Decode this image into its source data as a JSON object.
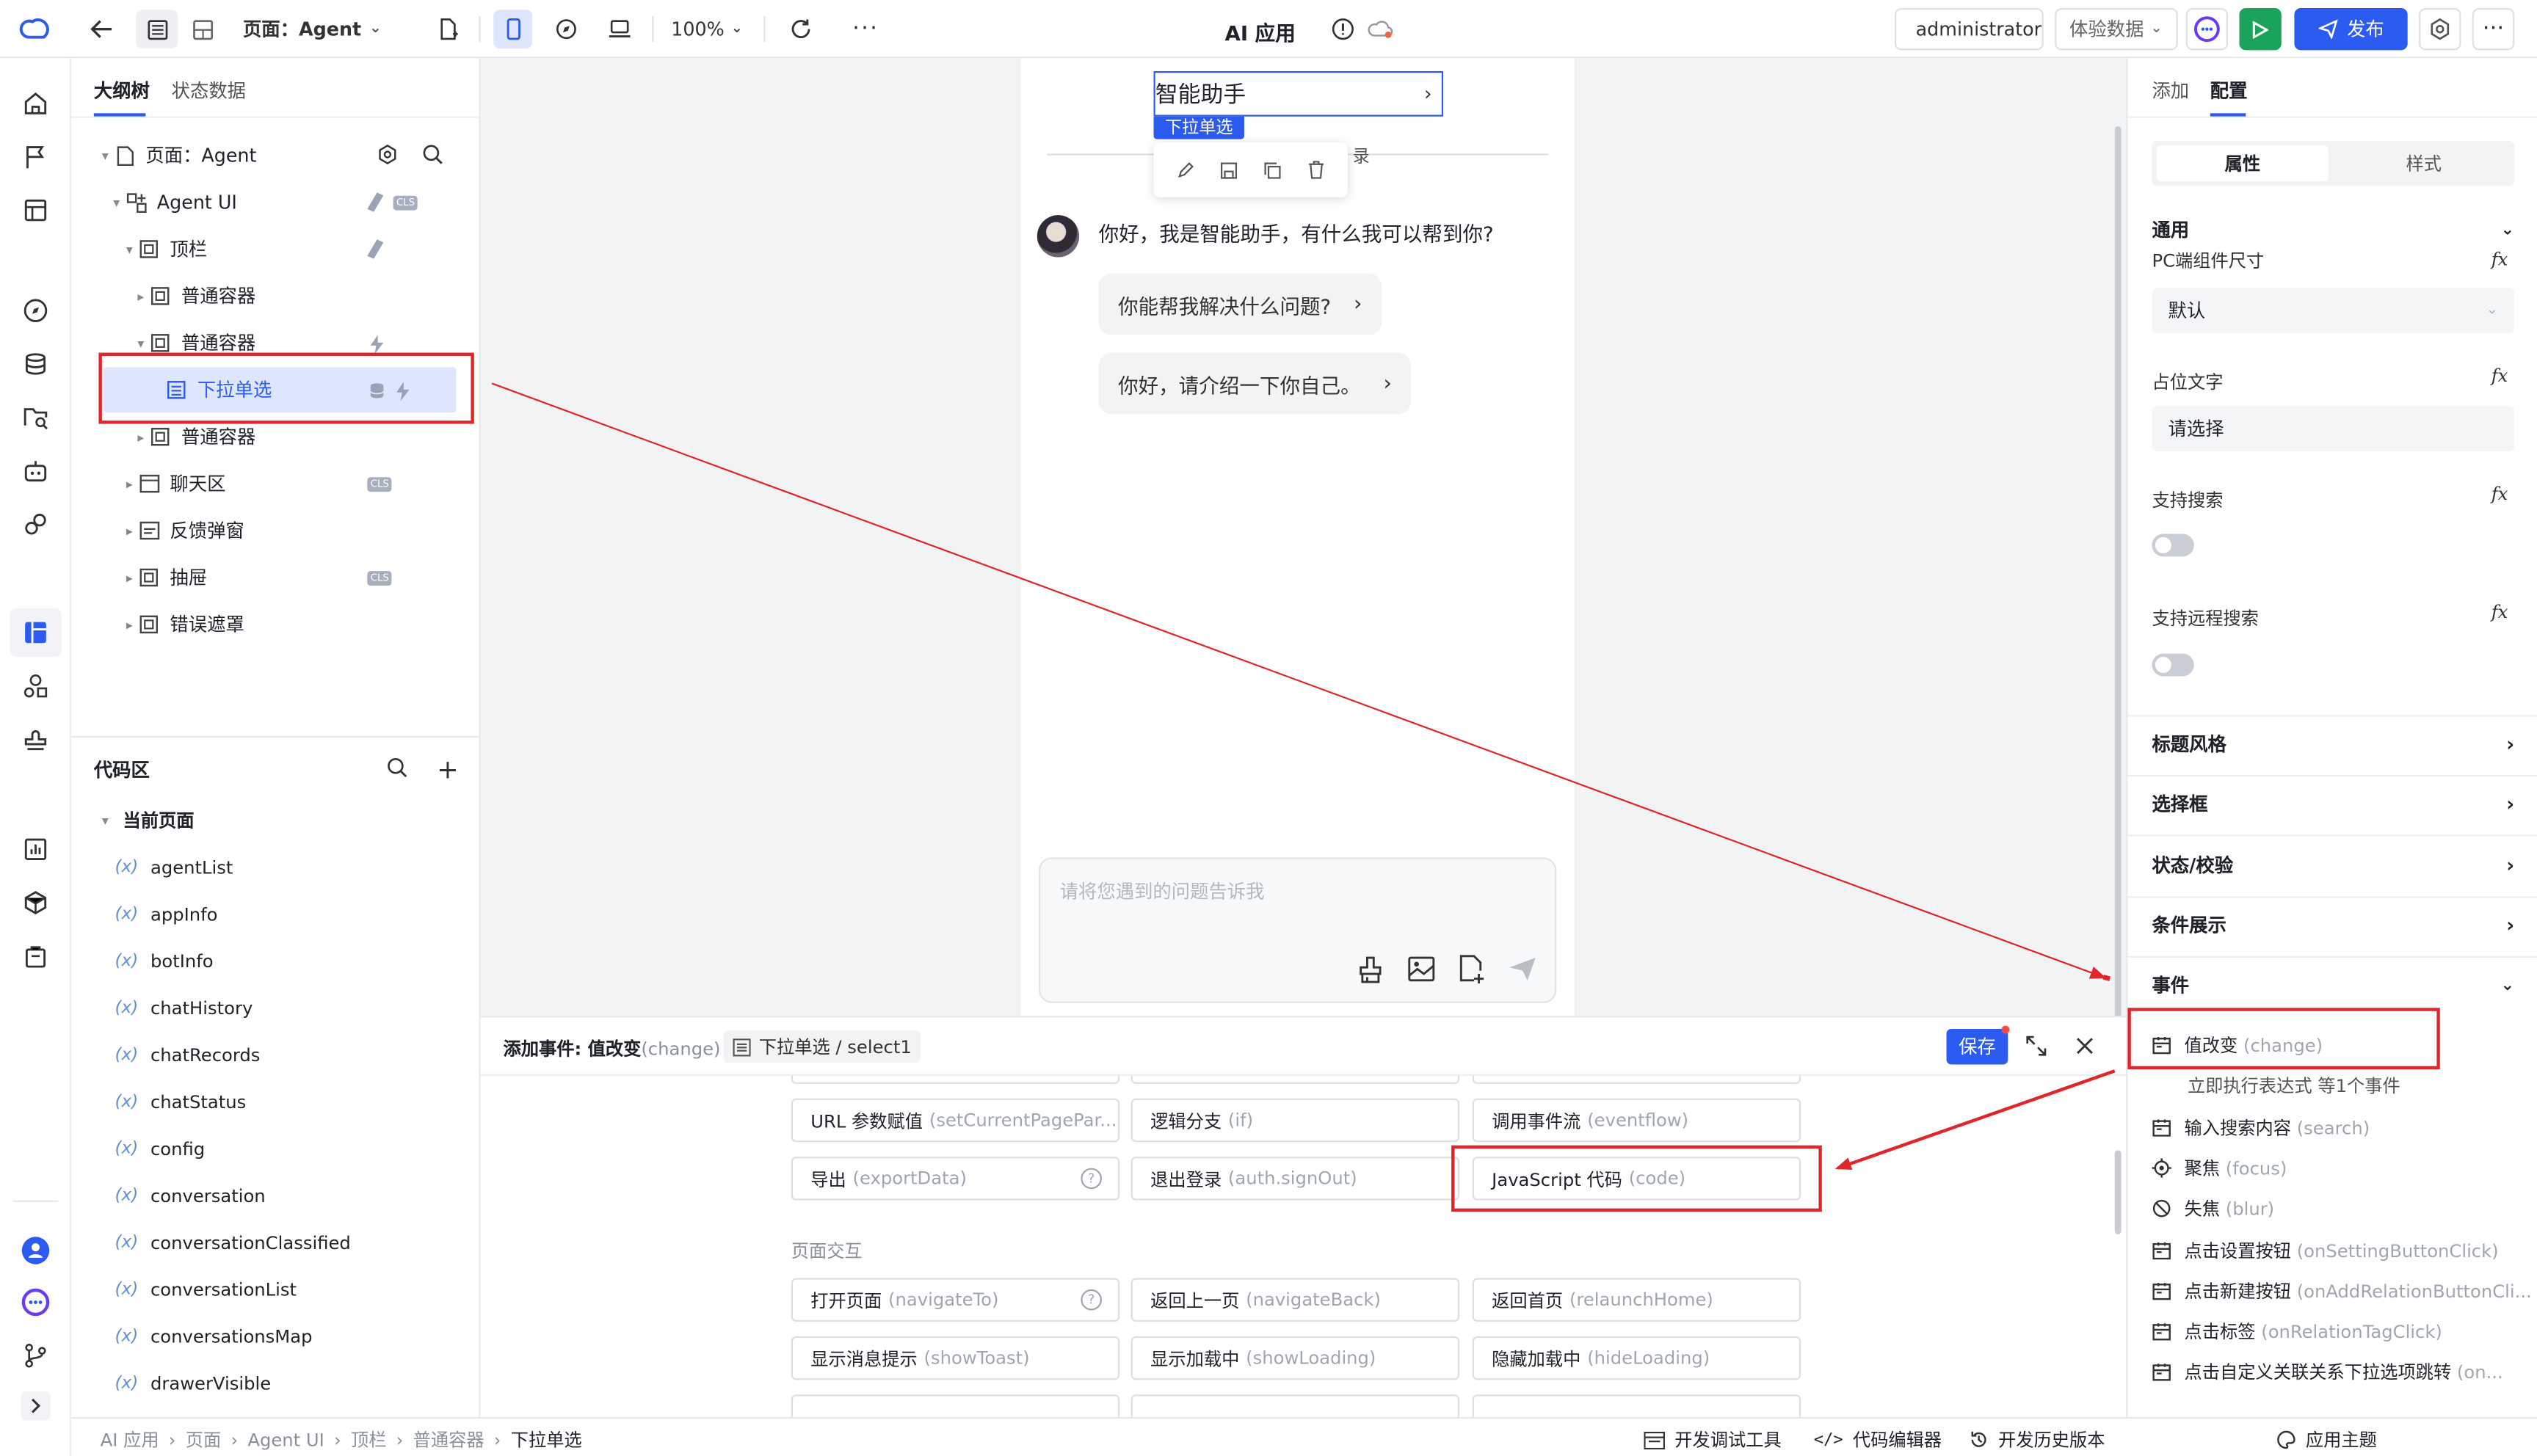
{
  "topbar": {
    "page_selector": "页面：Agent",
    "zoom": "100%",
    "app_title": "AI 应用",
    "user": "administrator",
    "data_mode": "体验数据",
    "publish": "发布"
  },
  "outline": {
    "tabs": [
      "大纲树",
      "状态数据"
    ],
    "tree": [
      {
        "label": "页面：Agent"
      },
      {
        "label": "Agent UI"
      },
      {
        "label": "顶栏"
      },
      {
        "label": "普通容器"
      },
      {
        "label": "普通容器"
      },
      {
        "label": "下拉单选"
      },
      {
        "label": "普通容器"
      },
      {
        "label": "聊天区"
      },
      {
        "label": "反馈弹窗"
      },
      {
        "label": "抽屉"
      },
      {
        "label": "错误遮罩"
      }
    ],
    "code_title": "代码区",
    "current_page": "当前页面",
    "variables": [
      "agentList",
      "appInfo",
      "botInfo",
      "chatHistory",
      "chatRecords",
      "chatStatus",
      "config",
      "conversation",
      "conversationClassified",
      "conversationList",
      "conversationsMap",
      "drawerVisible"
    ]
  },
  "canvas": {
    "selected_title": "智能助手",
    "selected_tag": "下拉单选",
    "record_tail": "录",
    "greeting": "你好，我是智能助手，有什么我可以帮到你?",
    "suggestions": [
      "你能帮我解决什么问题?",
      "你好，请介绍一下你自己。"
    ],
    "input_placeholder": "请将您遇到的问题告诉我"
  },
  "event_panel": {
    "title_prefix": "添加事件: 值改变",
    "title_en": "(change)",
    "target": "下拉单选 / select1",
    "save": "保存",
    "group_label": "页面交互",
    "row1": [
      {
        "zh": "URL 参数赋值",
        "en": "(setCurrentPagePar..."
      },
      {
        "zh": "逻辑分支",
        "en": "(if)"
      },
      {
        "zh": "调用事件流",
        "en": "(eventflow)"
      }
    ],
    "row2": [
      {
        "zh": "导出",
        "en": "(exportData)"
      },
      {
        "zh": "退出登录",
        "en": "(auth.signOut)"
      },
      {
        "zh": "JavaScript 代码",
        "en": "(code)"
      }
    ],
    "row3": [
      {
        "zh": "打开页面",
        "en": "(navigateTo)"
      },
      {
        "zh": "返回上一页",
        "en": "(navigateBack)"
      },
      {
        "zh": "返回首页",
        "en": "(relaunchHome)"
      }
    ],
    "row4": [
      {
        "zh": "显示消息提示",
        "en": "(showToast)"
      },
      {
        "zh": "显示加载中",
        "en": "(showLoading)"
      },
      {
        "zh": "隐藏加载中",
        "en": "(hideLoading)"
      }
    ]
  },
  "right_panel": {
    "tabs": [
      "添加",
      "配置"
    ],
    "segments": [
      "属性",
      "样式"
    ],
    "general": "通用",
    "size_label": "PC端组件尺寸",
    "size_value": "默认",
    "placeholder_label": "占位文字",
    "placeholder_value": "请选择",
    "search_label": "支持搜索",
    "remote_label": "支持远程搜索",
    "sections": [
      "标题风格",
      "选择框",
      "状态/校验",
      "条件展示"
    ],
    "events_label": "事件",
    "events": [
      {
        "zh": "值改变",
        "en": "(change)"
      },
      {
        "zh": "输入搜索内容",
        "en": "(search)"
      },
      {
        "zh": "聚焦",
        "en": "(focus)"
      },
      {
        "zh": "失焦",
        "en": "(blur)"
      },
      {
        "zh": "点击设置按钮",
        "en": "(onSettingButtonClick)"
      },
      {
        "zh": "点击新建按钮",
        "en": "(onAddRelationButtonCli..."
      },
      {
        "zh": "点击标签",
        "en": "(onRelationTagClick)"
      },
      {
        "zh": "点击自定义关联关系下拉选项跳转",
        "en": "(on..."
      }
    ],
    "event_sub": "立即执行表达式 等1个事件"
  },
  "statusbar": {
    "breadcrumb": [
      "AI 应用",
      "页面",
      "Agent UI",
      "顶栏",
      "普通容器",
      "下拉单选"
    ],
    "tools": [
      "开发调试工具",
      "代码编辑器",
      "开发历史版本",
      "应用主题"
    ]
  }
}
